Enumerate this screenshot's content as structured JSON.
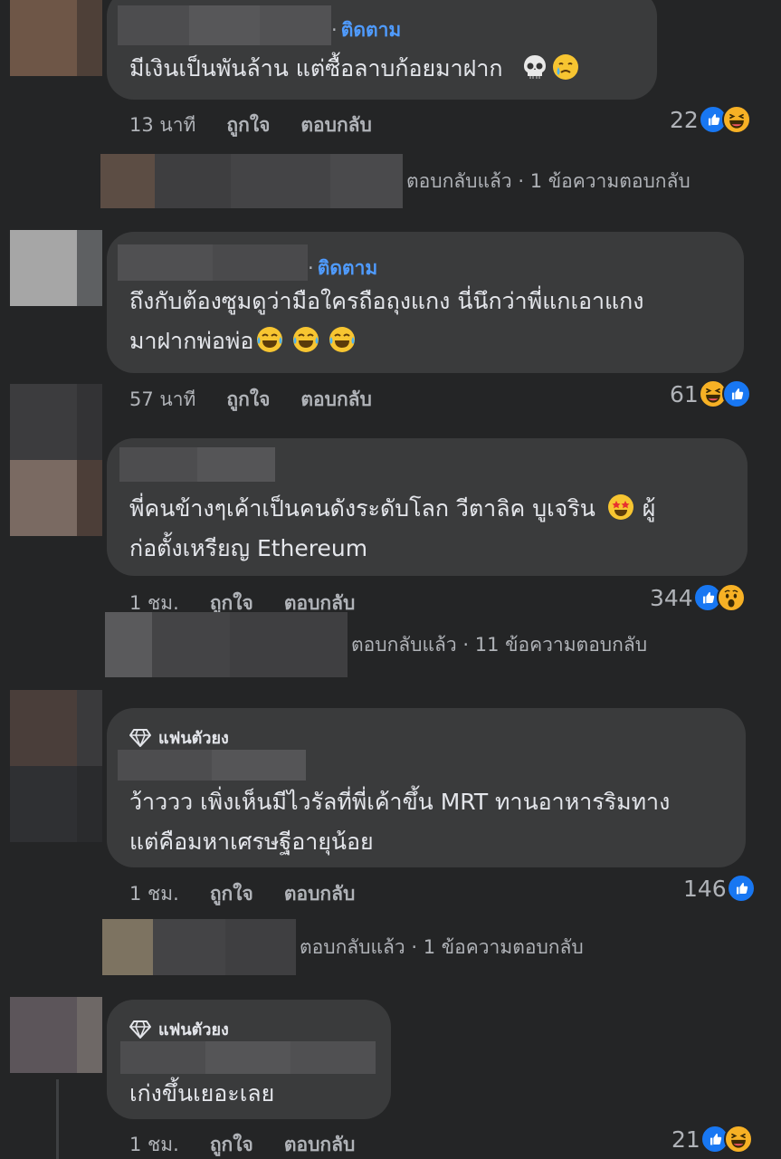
{
  "colors": {
    "background": "#242526",
    "bubble": "#3a3b3c",
    "link_blue": "#4f9bff",
    "meta_gray": "#b0b3b8",
    "like_blue": "#1877f2"
  },
  "comments": [
    {
      "follow": "ติดตาม",
      "lines": [
        "มีเงินเป็นพันล้าน แต่ซื้อลาบก้อยมาฝาก"
      ],
      "time": "13 นาที",
      "like_label": "ถูกใจ",
      "reply_label": "ตอบกลับ",
      "reaction_count": "22",
      "reactions": [
        "like-icon",
        "haha-icon"
      ],
      "inline_emojis": [
        "skull-emoji",
        "crying-emoji"
      ],
      "replies_text": "ตอบกลับแล้ว · 1 ข้อความตอบกลับ"
    },
    {
      "follow": "ติดตาม",
      "lines": [
        "ถึงกับต้องซูมดูว่ามือใครถือถุงแกง นี่นึกว่าพี่แกเอาแกง",
        "มาฝากพ่อพ่อ"
      ],
      "time": "57 นาที",
      "like_label": "ถูกใจ",
      "reply_label": "ตอบกลับ",
      "reaction_count": "61",
      "reactions": [
        "haha-icon",
        "like-icon"
      ],
      "inline_emojis": [
        "tears-of-joy-emoji",
        "tears-of-joy-emoji",
        "tears-of-joy-emoji"
      ]
    },
    {
      "lines": [
        "พี่คนข้างๆเค้าเป็นคนดังระดับโลก วีตาลิค บูเจริน",
        "ก่อตั้งเหรียญ Ethereum"
      ],
      "line1_tail": "ผู้",
      "time": "1 ชม.",
      "like_label": "ถูกใจ",
      "reply_label": "ตอบกลับ",
      "reaction_count": "344",
      "reactions": [
        "like-icon",
        "wow-icon"
      ],
      "inline_emojis": [
        "star-struck-emoji"
      ],
      "replies_text": "ตอบกลับแล้ว · 11 ข้อความตอบกลับ"
    },
    {
      "badge": "แฟนตัวยง",
      "lines": [
        "ว้าววว เพิ่งเห็นมีไวรัลที่พี่เค้าขึ้น MRT ทานอาหารริมทาง",
        "แต่คือมหาเศรษฐีอายุน้อย"
      ],
      "time": "1 ชม.",
      "like_label": "ถูกใจ",
      "reply_label": "ตอบกลับ",
      "reaction_count": "146",
      "reactions": [
        "like-icon"
      ],
      "replies_text": "ตอบกลับแล้ว · 1 ข้อความตอบกลับ"
    },
    {
      "badge": "แฟนตัวยง",
      "lines": [
        "เก่งขึ้นเยอะเลย"
      ],
      "time": "1 ชม.",
      "like_label": "ถูกใจ",
      "reply_label": "ตอบกลับ",
      "reaction_count": "21",
      "reactions": [
        "like-icon",
        "haha-icon"
      ]
    }
  ]
}
